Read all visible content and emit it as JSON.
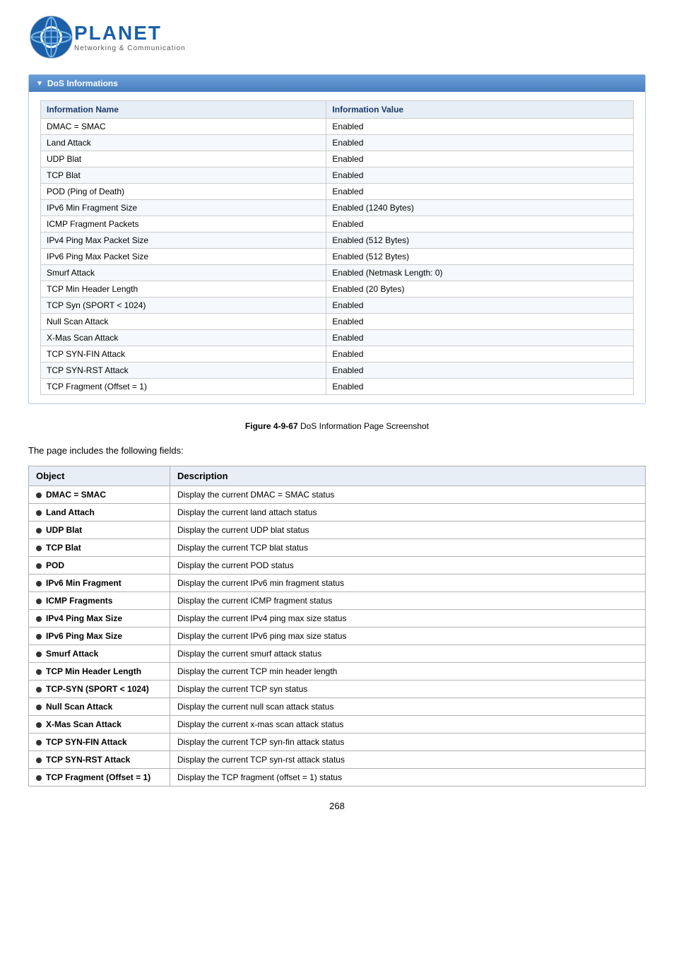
{
  "logo": {
    "brand": "PLANET",
    "tagline": "Networking & Communication"
  },
  "dos_section": {
    "header": "DoS Informations",
    "table": {
      "col1": "Information Name",
      "col2": "Information Value",
      "rows": [
        {
          "name": "DMAC = SMAC",
          "value": "Enabled"
        },
        {
          "name": "Land Attack",
          "value": "Enabled"
        },
        {
          "name": "UDP Blat",
          "value": "Enabled"
        },
        {
          "name": "TCP Blat",
          "value": "Enabled"
        },
        {
          "name": "POD (Ping of Death)",
          "value": "Enabled"
        },
        {
          "name": "IPv6 Min Fragment Size",
          "value": "Enabled (1240 Bytes)"
        },
        {
          "name": "ICMP Fragment Packets",
          "value": "Enabled"
        },
        {
          "name": "IPv4 Ping Max Packet Size",
          "value": "Enabled (512 Bytes)"
        },
        {
          "name": "IPv6 Ping Max Packet Size",
          "value": "Enabled (512 Bytes)"
        },
        {
          "name": "Smurf Attack",
          "value": "Enabled (Netmask Length: 0)"
        },
        {
          "name": "TCP Min Header Length",
          "value": "Enabled (20 Bytes)"
        },
        {
          "name": "TCP Syn (SPORT < 1024)",
          "value": "Enabled"
        },
        {
          "name": "Null Scan Attack",
          "value": "Enabled"
        },
        {
          "name": "X-Mas Scan Attack",
          "value": "Enabled"
        },
        {
          "name": "TCP SYN-FIN Attack",
          "value": "Enabled"
        },
        {
          "name": "TCP SYN-RST Attack",
          "value": "Enabled"
        },
        {
          "name": "TCP Fragment (Offset = 1)",
          "value": "Enabled"
        }
      ]
    }
  },
  "figure_caption": {
    "bold": "Figure 4-9-67",
    "text": " DoS Information Page Screenshot"
  },
  "page_description": "The page includes the following fields:",
  "desc_table": {
    "col1": "Object",
    "col2": "Description",
    "rows": [
      {
        "object": "DMAC = SMAC",
        "description": "Display the current DMAC = SMAC status"
      },
      {
        "object": "Land Attach",
        "description": "Display the current land attach status"
      },
      {
        "object": "UDP Blat",
        "description": "Display the current UDP blat status"
      },
      {
        "object": "TCP Blat",
        "description": "Display the current TCP blat status"
      },
      {
        "object": "POD",
        "description": "Display the current POD status"
      },
      {
        "object": "IPv6 Min Fragment",
        "description": "Display the current IPv6 min fragment status"
      },
      {
        "object": "ICMP Fragments",
        "description": "Display the current ICMP fragment status"
      },
      {
        "object": "IPv4 Ping Max Size",
        "description": "Display the current IPv4 ping max size status"
      },
      {
        "object": "IPv6 Ping Max Size",
        "description": "Display the current IPv6 ping max size status"
      },
      {
        "object": "Smurf Attack",
        "description": "Display the current smurf attack status"
      },
      {
        "object": "TCP Min Header Length",
        "description": "Display the current TCP min header length"
      },
      {
        "object": "TCP-SYN (SPORT < 1024)",
        "description": "Display the current TCP syn status"
      },
      {
        "object": "Null Scan Attack",
        "description": "Display the current null scan attack status"
      },
      {
        "object": "X-Mas Scan Attack",
        "description": "Display the current x-mas scan attack status"
      },
      {
        "object": "TCP SYN-FIN Attack",
        "description": "Display the current TCP syn-fin attack status"
      },
      {
        "object": "TCP SYN-RST Attack",
        "description": "Display the current TCP syn-rst attack status"
      },
      {
        "object": "TCP Fragment (Offset = 1)",
        "description": "Display the TCP fragment (offset = 1) status"
      }
    ]
  },
  "page_number": "268"
}
